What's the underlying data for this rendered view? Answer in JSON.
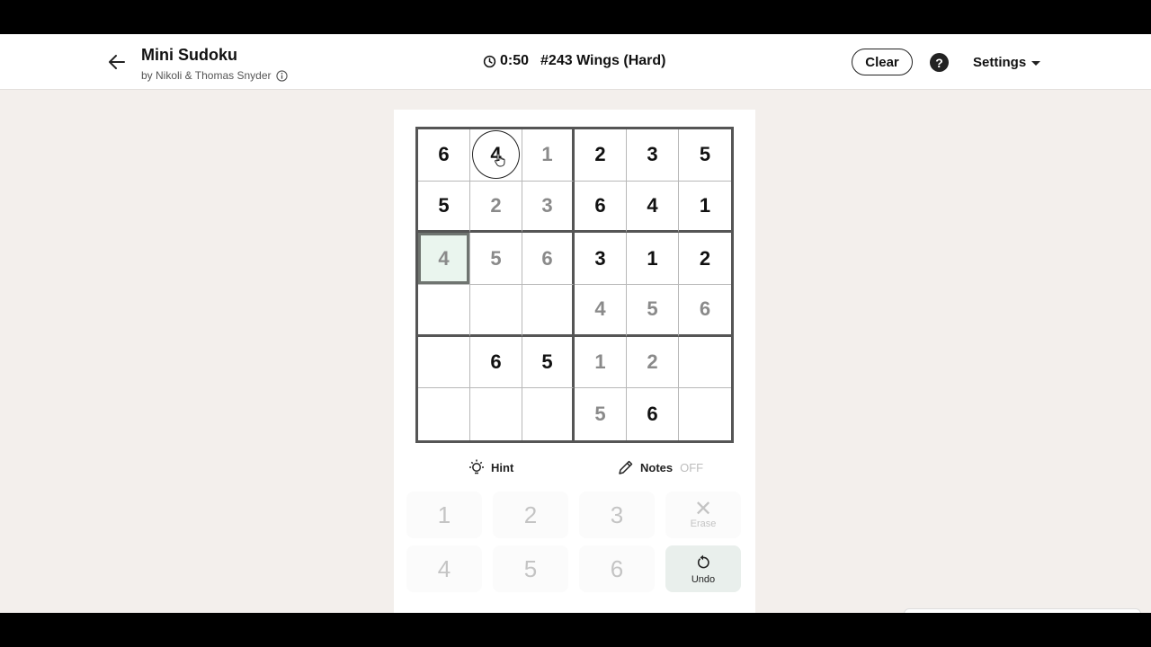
{
  "header": {
    "title": "Mini Sudoku",
    "byline": "by Nikoli & Thomas Snyder",
    "timer": "0:50",
    "puzzle": "#243 Wings (Hard)",
    "clear_label": "Clear",
    "help_label": "?",
    "settings_label": "Settings"
  },
  "grid": {
    "rows": [
      [
        {
          "v": "6",
          "kind": "given"
        },
        {
          "v": "4",
          "kind": "given"
        },
        {
          "v": "1",
          "kind": "entered"
        },
        {
          "v": "2",
          "kind": "given"
        },
        {
          "v": "3",
          "kind": "given"
        },
        {
          "v": "5",
          "kind": "given"
        }
      ],
      [
        {
          "v": "5",
          "kind": "given"
        },
        {
          "v": "2",
          "kind": "entered"
        },
        {
          "v": "3",
          "kind": "entered"
        },
        {
          "v": "6",
          "kind": "given"
        },
        {
          "v": "4",
          "kind": "given"
        },
        {
          "v": "1",
          "kind": "given"
        }
      ],
      [
        {
          "v": "4",
          "kind": "entered"
        },
        {
          "v": "5",
          "kind": "entered"
        },
        {
          "v": "6",
          "kind": "entered"
        },
        {
          "v": "3",
          "kind": "given"
        },
        {
          "v": "1",
          "kind": "given"
        },
        {
          "v": "2",
          "kind": "given"
        }
      ],
      [
        {
          "v": "",
          "kind": "empty"
        },
        {
          "v": "",
          "kind": "empty"
        },
        {
          "v": "",
          "kind": "empty"
        },
        {
          "v": "4",
          "kind": "entered"
        },
        {
          "v": "5",
          "kind": "entered"
        },
        {
          "v": "6",
          "kind": "entered"
        }
      ],
      [
        {
          "v": "",
          "kind": "empty"
        },
        {
          "v": "6",
          "kind": "given"
        },
        {
          "v": "5",
          "kind": "given"
        },
        {
          "v": "1",
          "kind": "entered"
        },
        {
          "v": "2",
          "kind": "entered"
        },
        {
          "v": "",
          "kind": "empty"
        }
      ],
      [
        {
          "v": "",
          "kind": "empty"
        },
        {
          "v": "",
          "kind": "empty"
        },
        {
          "v": "",
          "kind": "empty"
        },
        {
          "v": "5",
          "kind": "entered"
        },
        {
          "v": "6",
          "kind": "given"
        },
        {
          "v": "",
          "kind": "empty"
        }
      ]
    ],
    "selected": {
      "row": 2,
      "col": 0
    },
    "cursor": {
      "row": 0,
      "col": 1
    }
  },
  "tools": {
    "hint_label": "Hint",
    "notes_label": "Notes",
    "notes_state": "OFF"
  },
  "keypad": {
    "numbers": [
      "1",
      "2",
      "3",
      "4",
      "5",
      "6"
    ],
    "erase_label": "Erase",
    "undo_label": "Undo"
  },
  "colors": {
    "given": "#111111",
    "entered": "#8a8a8a",
    "selected_bg": "#eaf5ee",
    "background": "#f3efec"
  }
}
